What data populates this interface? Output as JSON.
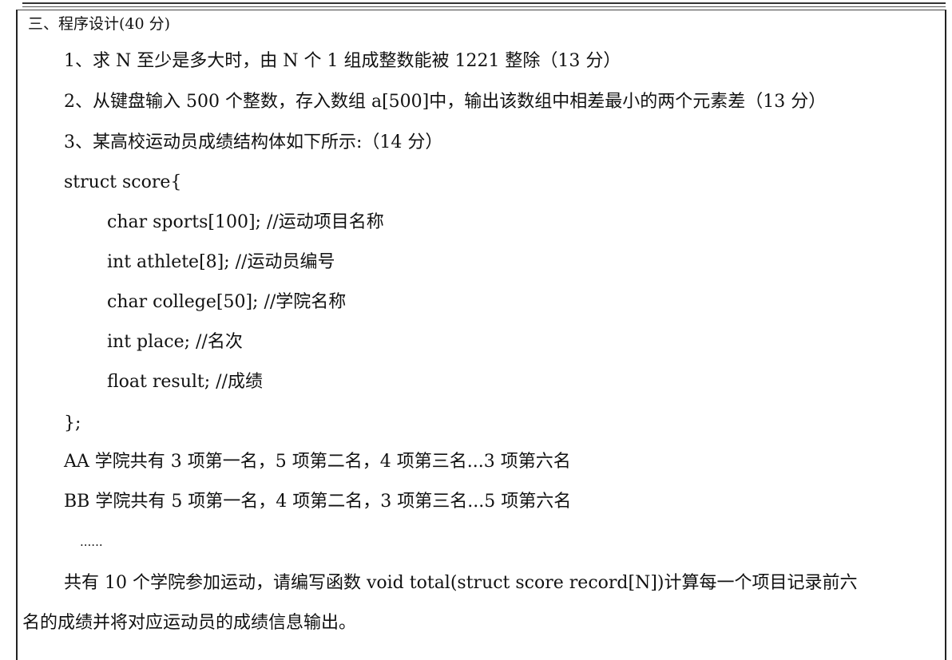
{
  "section_heading": "三、程序设计(40 分)",
  "questions": [
    "1、求 N 至少是多大时，由 N 个 1 组成整数能被 1221 整除（13 分）",
    "2、从键盘输入 500 个整数，存入数组 a[500]中，输出该数组中相差最小的两个元素差（13 分）",
    "3、某高校运动员成绩结构体如下所示:（14 分）"
  ],
  "code": [
    "struct score{",
    "char sports[100]; //运动项目名称",
    "int athlete[8]; //运动员编号",
    "char college[50]; //学院名称",
    "int place; //名次",
    "float result; //成绩",
    "};"
  ],
  "examples": [
    "AA 学院共有 3 项第一名，5 项第二名，4 项第三名...3 项第六名",
    "BB 学院共有 5 项第一名，4 项第二名，3 项第三名...5 项第六名"
  ],
  "ellipsis": "......",
  "task_paragraph": [
    "共有 10 个学院参加运动，请编写函数 void total(struct score record[N])计算每一个项目记录前六",
    "名的成绩并将对应运动员的成绩信息输出。"
  ]
}
